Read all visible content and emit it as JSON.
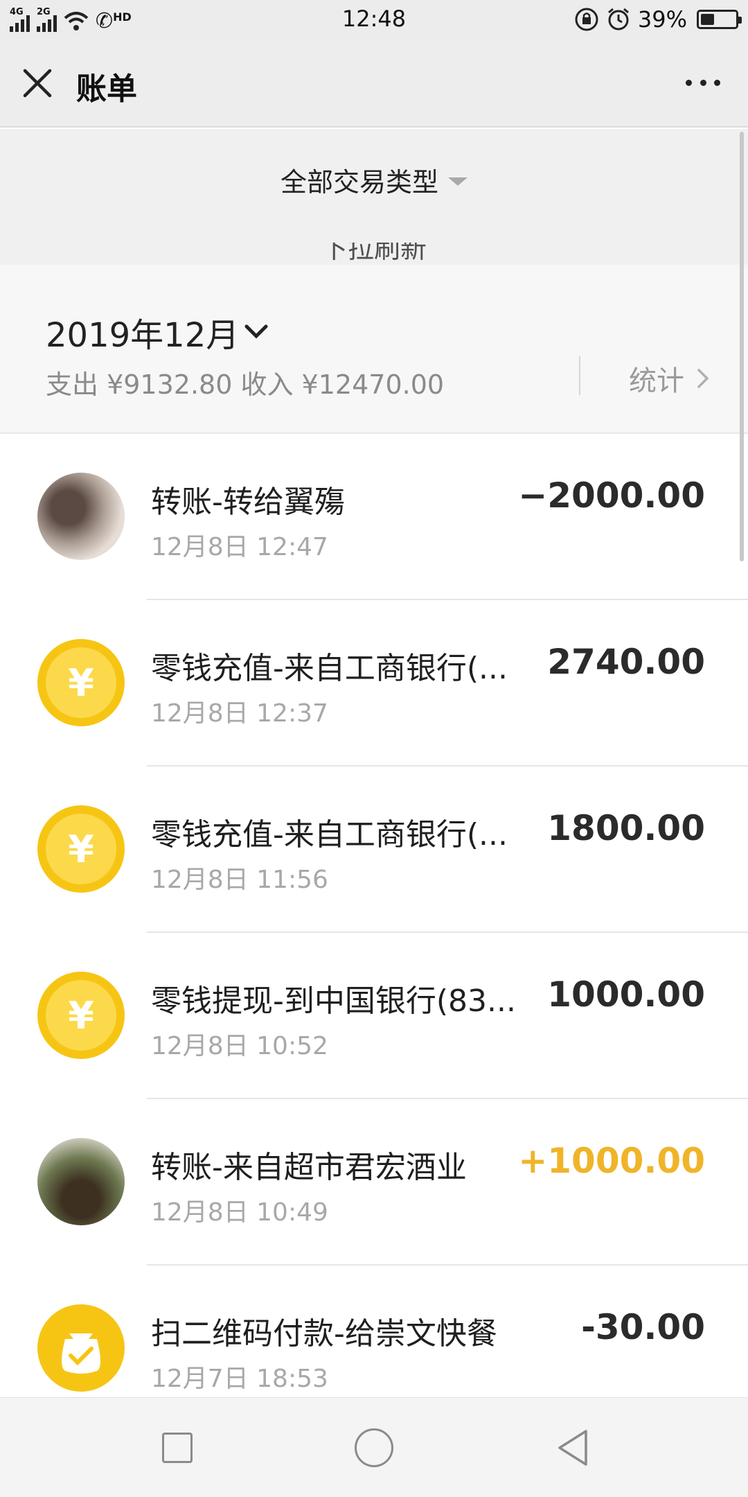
{
  "status_bar": {
    "time": "12:48",
    "network_1": "4G",
    "network_2": "2G",
    "hd_label": "HD",
    "battery_percent": "39%",
    "battery_level": 0.39,
    "icons": [
      "signal-icon",
      "wifi-icon",
      "volte-call-icon",
      "rotation-lock-icon",
      "alarm-icon",
      "battery-icon"
    ]
  },
  "header": {
    "title": "账单",
    "close_icon": "close-icon",
    "more_icon": "more-icon"
  },
  "filter": {
    "type_label": "全部交易类型",
    "pull_refresh_text": "下拉刷新"
  },
  "month": {
    "label": "2019年12月",
    "summary": "支出 ¥9132.80 收入 ¥12470.00",
    "stats_label": "统计"
  },
  "transactions": [
    {
      "title": "转账-转给翼殤",
      "time": "12月8日 12:47",
      "amount": "−2000.00",
      "kind": "expense",
      "avatar": "photo"
    },
    {
      "title": "零钱充值-来自工商银行(...",
      "time": "12月8日 12:37",
      "amount": "2740.00",
      "kind": "neutral",
      "avatar": "yuan-coin"
    },
    {
      "title": "零钱充值-来自工商银行(...",
      "time": "12月8日 11:56",
      "amount": "1800.00",
      "kind": "neutral",
      "avatar": "yuan-coin"
    },
    {
      "title": "零钱提现-到中国银行(83...",
      "time": "12月8日 10:52",
      "amount": "1000.00",
      "kind": "neutral",
      "avatar": "yuan-coin"
    },
    {
      "title": "转账-来自超市君宏酒业",
      "time": "12月8日 10:49",
      "amount": "+1000.00",
      "kind": "income",
      "avatar": "photo"
    },
    {
      "title": "扫二维码付款-给崇文快餐",
      "time": "12月7日 18:53",
      "amount": "-30.00",
      "kind": "expense",
      "avatar": "money-bag"
    }
  ],
  "colors": {
    "income": "#f0b429",
    "coin": "#f6c514",
    "header_bg": "#ededed"
  },
  "nav_bar": {
    "icons": [
      "recent-apps-icon",
      "home-icon",
      "back-icon"
    ]
  }
}
